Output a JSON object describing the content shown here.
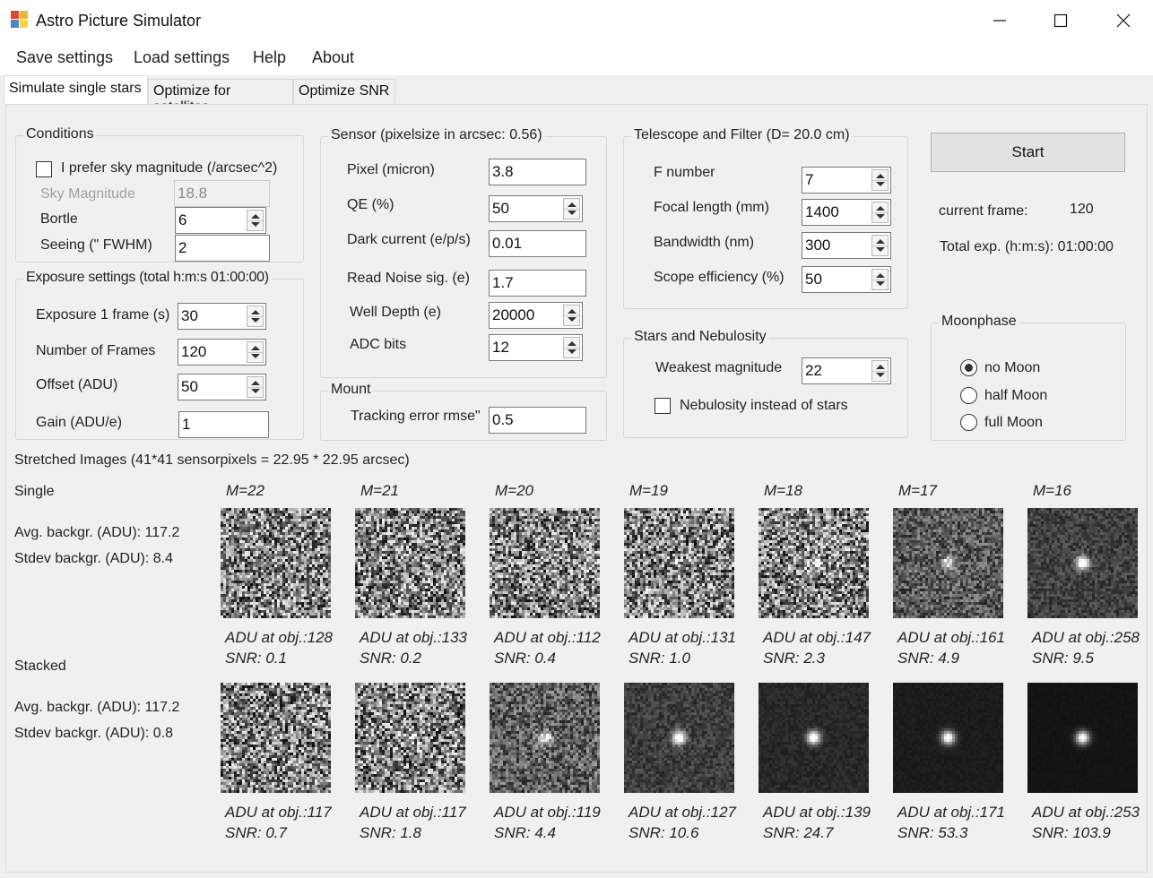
{
  "window": {
    "title": "Astro Picture Simulator",
    "controls": {
      "minimize": "minimize-icon",
      "maximize": "maximize-icon",
      "close": "close-icon"
    }
  },
  "menu": [
    "Save settings",
    "Load settings",
    "Help",
    "About"
  ],
  "tabs": [
    {
      "label": "Simulate single stars",
      "active": true
    },
    {
      "label": "Optimize for satellites",
      "active": false
    },
    {
      "label": "Optimize SNR",
      "active": false
    }
  ],
  "conditions": {
    "title": "Conditions",
    "prefer_sky_mag_label": "I prefer sky magnitude (/arcsec^2)",
    "prefer_sky_mag_checked": false,
    "sky_magnitude_label": "Sky Magnitude",
    "sky_magnitude_value": "18.8",
    "bortle_label": "Bortle",
    "bortle_value": "6",
    "seeing_label": "Seeing (\" FWHM)",
    "seeing_value": "2"
  },
  "exposure": {
    "title": "Exposure settings (total h:m:s 01:00:00)",
    "exposure_label": "Exposure 1 frame (s)",
    "exposure_value": "30",
    "frames_label": "Number of Frames",
    "frames_value": "120",
    "offset_label": "Offset (ADU)",
    "offset_value": "50",
    "gain_label": "Gain (ADU/e)",
    "gain_value": "1"
  },
  "sensor": {
    "title": "Sensor  (pixelsize in arcsec: 0.56)",
    "pixel_label": "Pixel (micron)",
    "pixel_value": "3.8",
    "qe_label": "QE (%)",
    "qe_value": "50",
    "dark_label": "Dark current (e/p/s)",
    "dark_value": "0.01",
    "read_noise_label": "Read Noise sig. (e)",
    "read_noise_value": "1.7",
    "well_label": "Well Depth (e)",
    "well_value": "20000",
    "adc_label": "ADC bits",
    "adc_value": "12"
  },
  "mount": {
    "title": "Mount",
    "tracking_label": "Tracking error rmse\"",
    "tracking_value": "0.5"
  },
  "telescope": {
    "title": "Telescope and Filter (D= 20.0 cm)",
    "fnumber_label": "F number",
    "fnumber_value": "7",
    "focal_label": "Focal length (mm)",
    "focal_value": "1400",
    "bandwidth_label": "Bandwidth (nm)",
    "bandwidth_value": "300",
    "efficiency_label": "Scope efficiency (%)",
    "efficiency_value": "50"
  },
  "stars": {
    "title": "Stars and Nebulosity",
    "weakest_label": "Weakest magnitude",
    "weakest_value": "22",
    "nebulosity_label": "Nebulosity instead of stars",
    "nebulosity_checked": false
  },
  "run": {
    "start_label": "Start",
    "current_frame_label": "current frame:",
    "current_frame_value": "120",
    "total_exp_label": "Total exp. (h:m:s): 01:00:00"
  },
  "moonphase": {
    "title": "Moonphase",
    "options": [
      {
        "label": "no Moon",
        "checked": true
      },
      {
        "label": "half Moon",
        "checked": false
      },
      {
        "label": "full Moon",
        "checked": false
      }
    ]
  },
  "images": {
    "title": "Stretched Images (41*41 sensorpixels = 22.95 * 22.95 arcsec)",
    "single": {
      "label": "Single",
      "avg": "Avg. backgr. (ADU): 117.2",
      "stdev": "Stdev backgr. (ADU): 8.4"
    },
    "stacked": {
      "label": "Stacked",
      "avg": "Avg. backgr. (ADU): 117.2",
      "stdev": "Stdev backgr. (ADU): 0.8"
    },
    "magnitudes": [
      "M=22",
      "M=21",
      "M=20",
      "M=19",
      "M=18",
      "M=17",
      "M=16"
    ],
    "single_results": [
      {
        "adu": "ADU at obj.:128",
        "snr": "SNR: 0.1"
      },
      {
        "adu": "ADU at obj.:133",
        "snr": "SNR: 0.2"
      },
      {
        "adu": "ADU at obj.:112",
        "snr": "SNR: 0.4"
      },
      {
        "adu": "ADU at obj.:131",
        "snr": "SNR: 1.0"
      },
      {
        "adu": "ADU at obj.:147",
        "snr": "SNR: 2.3"
      },
      {
        "adu": "ADU at obj.:161",
        "snr": "SNR: 4.9"
      },
      {
        "adu": "ADU at obj.:258",
        "snr": "SNR: 9.5"
      }
    ],
    "stacked_results": [
      {
        "adu": "ADU at obj.:117",
        "snr": "SNR: 0.7"
      },
      {
        "adu": "ADU at obj.:117",
        "snr": "SNR: 1.8"
      },
      {
        "adu": "ADU at obj.:119",
        "snr": "SNR: 4.4"
      },
      {
        "adu": "ADU at obj.:127",
        "snr": "SNR: 10.6"
      },
      {
        "adu": "ADU at obj.:139",
        "snr": "SNR: 24.7"
      },
      {
        "adu": "ADU at obj.:171",
        "snr": "SNR: 53.3"
      },
      {
        "adu": "ADU at obj.:253",
        "snr": "SNR: 103.9"
      }
    ],
    "single_snr": [
      0.1,
      0.2,
      0.4,
      1.0,
      2.3,
      4.9,
      9.5
    ],
    "stacked_snr": [
      0.7,
      1.8,
      4.4,
      10.6,
      24.7,
      53.3,
      103.9
    ]
  }
}
